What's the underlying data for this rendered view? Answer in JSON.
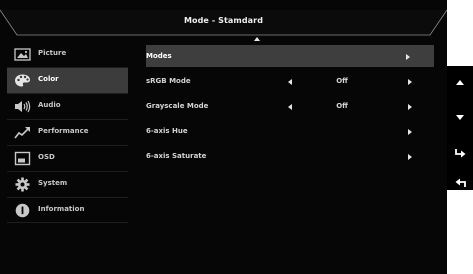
{
  "header": {
    "title": "Mode - Stamdard"
  },
  "sidebar": {
    "items": [
      {
        "label": "Picture",
        "icon": "picture-icon",
        "active": false
      },
      {
        "label": "Color",
        "icon": "palette-icon",
        "active": true
      },
      {
        "label": "Audio",
        "icon": "speaker-icon",
        "active": false
      },
      {
        "label": "Performance",
        "icon": "performance-icon",
        "active": false
      },
      {
        "label": "OSD",
        "icon": "osd-icon",
        "active": false
      },
      {
        "label": "System",
        "icon": "gear-icon",
        "active": false
      },
      {
        "label": "Information",
        "icon": "info-icon",
        "active": false
      }
    ]
  },
  "settings": {
    "rows": [
      {
        "label": "Modes",
        "value": "",
        "has_left_arrow": false,
        "selected": true
      },
      {
        "label": "sRGB Mode",
        "value": "Off",
        "has_left_arrow": true,
        "selected": false
      },
      {
        "label": "Grayscale Mode",
        "value": "Off",
        "has_left_arrow": true,
        "selected": false
      },
      {
        "label": "6-axis Hue",
        "value": "",
        "has_left_arrow": false,
        "selected": false
      },
      {
        "label": "6-axis Saturate",
        "value": "",
        "has_left_arrow": false,
        "selected": false
      }
    ]
  },
  "keys": [
    {
      "icon": "arrow-up-icon"
    },
    {
      "icon": "arrow-down-icon"
    },
    {
      "icon": "enter-icon"
    },
    {
      "icon": "return-icon"
    }
  ],
  "colors": {
    "panel_bg": "#060606",
    "active_item_bg": "#3c3c3c",
    "selected_row_bg": "#3e3e3e",
    "text": "#d4d4d4",
    "title_text": "#f0f0f0"
  }
}
